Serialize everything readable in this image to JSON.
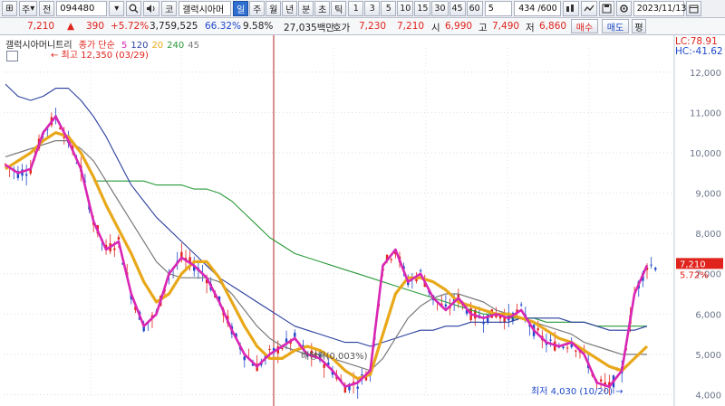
{
  "toolbar": {
    "nav_prev": "⊞",
    "market": "주",
    "market_arrow": "▾",
    "type": "전",
    "code": "094480",
    "search_icon": "search-icon",
    "speaker_icon": "speaker-icon",
    "kr": "코",
    "name": "갤럭시아머",
    "period_tabs": [
      "일",
      "주",
      "월",
      "년",
      "분",
      "초",
      "틱"
    ],
    "period_selected": "일",
    "minute_units": [
      "1",
      "3",
      "5",
      "10",
      "15",
      "30",
      "45",
      "60"
    ],
    "count_select": "5",
    "pages": "434 /600",
    "date": "2023/11/13"
  },
  "quote": {
    "price": "7,210",
    "change": "390",
    "rate": "+5.72%",
    "volume": "3,759,525",
    "vol_ratio": "66.32%",
    "turnover": "9.58%",
    "amount": "27,035백만",
    "ask_label": "호가",
    "ask1": "7,230",
    "ask2": "7,210",
    "open_label": "시",
    "open": "6,990",
    "high_label": "고",
    "high": "7,490",
    "low_label": "저",
    "low": "6,860",
    "buy_label": "매수",
    "sell_label": "매도",
    "eval_label": "평"
  },
  "legend": {
    "name": "갤럭시아머니트리",
    "ma_label": "종가 단순",
    "ma_periods": [
      "5",
      "120",
      "20",
      "240",
      "45"
    ],
    "ma_colors": [
      "#d926b4",
      "#2a3f9e",
      "#e8a81a",
      "#2a9a3a",
      "#7a7a7a"
    ]
  },
  "right_info": {
    "lc": "LC:78.91",
    "hc": "HC:-41.62",
    "price_tag": "7,210",
    "rate_tag": "5.72%"
  },
  "chart_data": {
    "type": "candlestick",
    "ylim": [
      3900,
      12600
    ],
    "y_ticks": [
      4000,
      5000,
      6000,
      7000,
      8000,
      9000,
      10000,
      11000,
      12000
    ],
    "y_tick_labels": [
      "4,000",
      "5,000",
      "6,000",
      "7,000",
      "8,000",
      "9,000",
      "10,000",
      "11,000",
      "12,000"
    ],
    "annotations": {
      "high": "최고 12,350 (03/29)",
      "low": "최저 4,030 (10/20)",
      "ex_rights": "배당락(0.003%)"
    },
    "series": [
      {
        "name": "5",
        "color": "#d926b4",
        "values": [
          9700,
          9500,
          9600,
          10500,
          10900,
          10300,
          9600,
          8300,
          7600,
          7800,
          6500,
          5700,
          6000,
          7000,
          7400,
          7200,
          6900,
          6300,
          5600,
          5000,
          4700,
          5000,
          5200,
          5400,
          5000,
          4900,
          4600,
          4200,
          4300,
          4600,
          7200,
          7600,
          6800,
          7000,
          6400,
          6100,
          6400,
          6000,
          5900,
          6000,
          5900,
          6100,
          5600,
          5300,
          5200,
          5300,
          5000,
          4300,
          4200,
          4600,
          6500,
          7210
        ]
      },
      {
        "name": "20",
        "color": "#e8a81a",
        "values": [
          9600,
          9800,
          10000,
          10300,
          10500,
          10400,
          10000,
          9400,
          8700,
          8100,
          7500,
          6800,
          6300,
          6500,
          7000,
          7300,
          7300,
          6900,
          6300,
          5700,
          5200,
          4900,
          4900,
          5100,
          5200,
          5100,
          4900,
          4600,
          4400,
          4500,
          5500,
          6500,
          6900,
          6900,
          6800,
          6600,
          6300,
          6200,
          6100,
          6000,
          6000,
          5900,
          5800,
          5600,
          5400,
          5300,
          5100,
          4900,
          4700,
          4600,
          4900,
          5200
        ]
      },
      {
        "name": "45",
        "color": "#7a7a7a",
        "values": [
          9900,
          10000,
          10100,
          10200,
          10300,
          10300,
          10100,
          9800,
          9300,
          8800,
          8300,
          7800,
          7300,
          7000,
          6900,
          6900,
          6900,
          6800,
          6500,
          6100,
          5700,
          5400,
          5200,
          5100,
          5000,
          5000,
          4900,
          4800,
          4700,
          4600,
          4900,
          5400,
          5900,
          6200,
          6400,
          6500,
          6500,
          6400,
          6300,
          6100,
          6000,
          5900,
          5800,
          5700,
          5600,
          5500,
          5300,
          5200,
          5100,
          5000,
          5000,
          5000
        ]
      },
      {
        "name": "120",
        "color": "#2a3f9e",
        "values": [
          11700,
          11400,
          11300,
          11400,
          11600,
          11600,
          11300,
          10900,
          10400,
          9800,
          9200,
          8800,
          8400,
          8100,
          7800,
          7500,
          7200,
          6900,
          6700,
          6500,
          6300,
          6100,
          5900,
          5700,
          5600,
          5500,
          5400,
          5300,
          5300,
          5200,
          5300,
          5400,
          5500,
          5600,
          5600,
          5700,
          5700,
          5800,
          5800,
          5800,
          5800,
          5900,
          5900,
          5900,
          5900,
          5800,
          5800,
          5700,
          5600,
          5600,
          5600,
          5700
        ]
      },
      {
        "name": "240",
        "color": "#2a9a3a",
        "values": [
          null,
          null,
          null,
          null,
          null,
          null,
          null,
          9300,
          9300,
          9300,
          9300,
          9300,
          9200,
          9200,
          9200,
          9100,
          9100,
          9000,
          8800,
          8500,
          8200,
          7900,
          7700,
          7500,
          7400,
          7300,
          7200,
          7100,
          7000,
          6900,
          6800,
          6700,
          6600,
          6500,
          6400,
          6300,
          6200,
          6100,
          6000,
          6000,
          5900,
          5900,
          5900,
          5800,
          5800,
          5800,
          5800,
          5700,
          5700,
          5700,
          5700,
          5700
        ]
      }
    ]
  }
}
